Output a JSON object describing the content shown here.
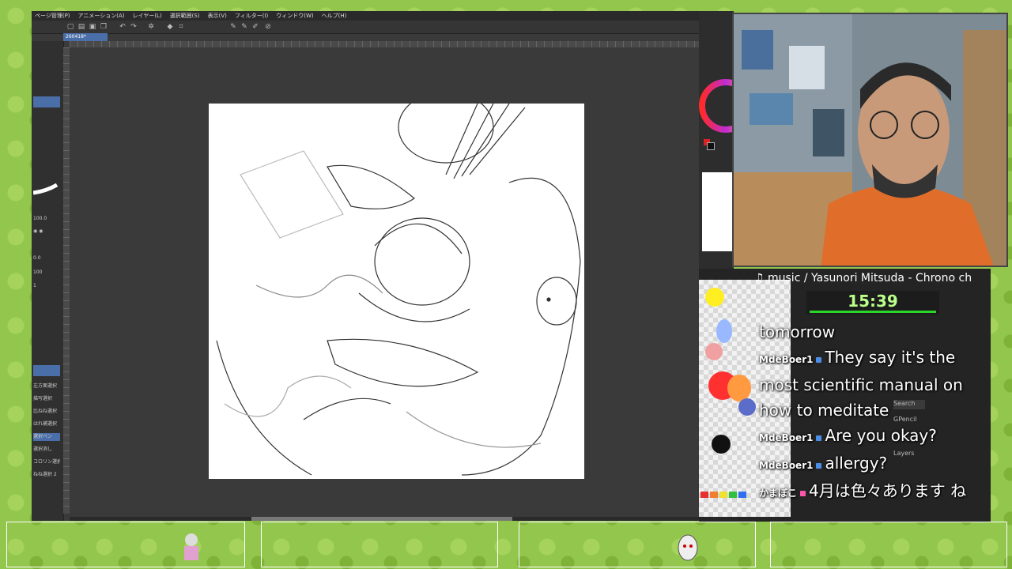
{
  "menu": [
    "ページ管理(P)",
    "アニメーション(A)",
    "レイヤー(L)",
    "選択範囲(S)",
    "表示(V)",
    "フィルター(I)",
    "ウィンドウ(W)",
    "ヘルプ(H)"
  ],
  "document_tab": "260418*",
  "left_panel": {
    "size_value": "100.0",
    "opacity_value": "100",
    "brush_size": "0.0",
    "zoom_value": "1",
    "items": [
      "左方面選択",
      "描写選択",
      "比ねね選択",
      "はれ補選択",
      "選択ペン",
      "選択消し",
      "コロリン選択",
      "ねね選択 2"
    ]
  },
  "right_panel": {
    "labels": [
      "カラー",
      "ナビ",
      "GPencil",
      "Layers",
      "Search"
    ]
  },
  "stream": {
    "music": "♫ music / Yasunori Mitsuda - Chrono ch",
    "timer": "15:39",
    "chat": [
      {
        "user": "",
        "text": "tomorrow"
      },
      {
        "user": "MdeBoer1",
        "text": "They say it's the most scientific manual on how to meditate"
      },
      {
        "user": "MdeBoer1",
        "text": "Are you okay?"
      },
      {
        "user": "MdeBoer1",
        "text": "allergy?"
      },
      {
        "user": "かまぼこ",
        "text": "4月は色々あります ね"
      }
    ]
  },
  "colors": {
    "accent": "#4a6ea8",
    "timer_text": "#b9ff8a",
    "timer_bar": "#2bd62b"
  }
}
